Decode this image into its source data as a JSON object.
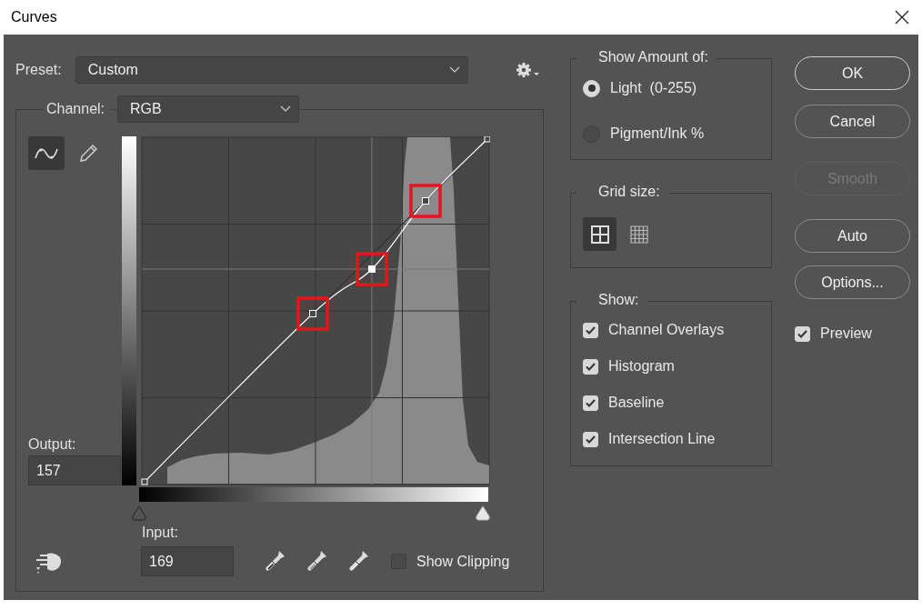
{
  "window": {
    "title": "Curves"
  },
  "preset": {
    "label": "Preset:",
    "value": "Custom"
  },
  "channel": {
    "label": "Channel:",
    "value": "RGB"
  },
  "curve_tools": [
    {
      "kind": "curve",
      "selected": true
    },
    {
      "kind": "pencil",
      "selected": false
    }
  ],
  "control_points": [
    {
      "selected": false,
      "highlighted": true
    },
    {
      "selected": true,
      "highlighted": true
    },
    {
      "selected": false,
      "highlighted": true
    }
  ],
  "output": {
    "label": "Output:",
    "value": "157"
  },
  "input_sliders": [
    {
      "kind": "shadows"
    },
    {
      "kind": "highlights"
    }
  ],
  "input": {
    "label": "Input:",
    "value": "169"
  },
  "show_clipping": {
    "label": "Show Clipping",
    "checked": false
  },
  "show_amount": {
    "title": "Show Amount of:",
    "options": [
      {
        "label": "Light  (0-255)",
        "selected": true
      },
      {
        "label": "Pigment/Ink %",
        "selected": false
      }
    ]
  },
  "grid_size": {
    "title": "Grid size:",
    "options": [
      {
        "kind": "simple",
        "selected": true
      },
      {
        "kind": "detailed",
        "selected": false
      }
    ]
  },
  "show": {
    "title": "Show:",
    "options": [
      {
        "label": "Channel Overlays",
        "checked": true
      },
      {
        "label": "Histogram",
        "checked": true
      },
      {
        "label": "Baseline",
        "checked": true
      },
      {
        "label": "Intersection Line",
        "checked": true
      }
    ]
  },
  "buttons": [
    {
      "label": "OK",
      "default": true,
      "disabled": false
    },
    {
      "label": "Cancel",
      "default": false,
      "disabled": false
    },
    {
      "label": "Smooth",
      "default": false,
      "disabled": true
    },
    {
      "label": "Auto",
      "default": false,
      "disabled": false
    },
    {
      "label": "Options...",
      "default": false,
      "disabled": false
    }
  ],
  "preview": {
    "label": "Preview",
    "checked": true
  }
}
